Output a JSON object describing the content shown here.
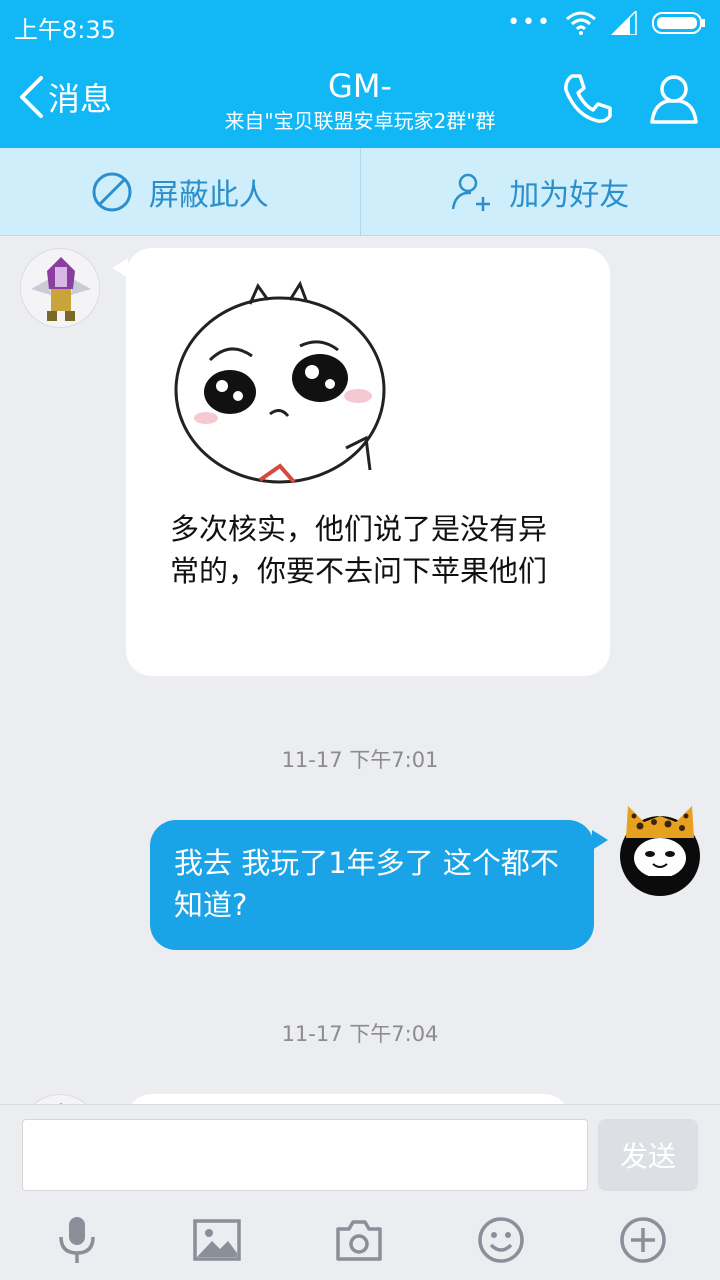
{
  "statusbar": {
    "time": "上午8:35"
  },
  "header": {
    "back_label": "消息",
    "title": "GM-",
    "subtitle": "来自\"宝贝联盟安卓玩家2群\"群"
  },
  "actions": {
    "block_label": "屏蔽此人",
    "add_friend_label": "加为好友"
  },
  "messages": [
    {
      "direction": "incoming",
      "sticker": "crying-face-sticker",
      "text": "多次核实，他们说了是没有异常的，你要不去问下苹果他们"
    },
    {
      "timestamp": "11-17 下午7:01"
    },
    {
      "direction": "outgoing",
      "text": "我去 我玩了1年多了  这个都不知道?"
    },
    {
      "timestamp": "11-17 下午7:04"
    }
  ],
  "input": {
    "placeholder": "",
    "send_label": "发送"
  },
  "toolbar": [
    "microphone-icon",
    "image-icon",
    "camera-icon",
    "emoji-icon",
    "plus-icon"
  ],
  "colors": {
    "accent": "#12b7f5",
    "outgoing_bubble": "#1aa3e6",
    "action_bar": "#cfeefb",
    "background": "#ebedf0"
  }
}
